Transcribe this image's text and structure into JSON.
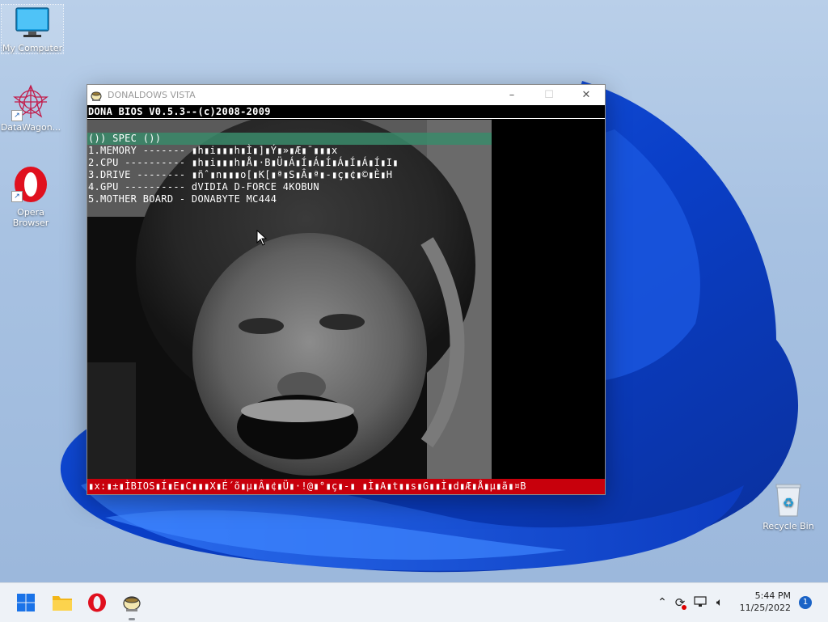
{
  "desktop": {
    "icons": [
      {
        "label": "My Computer"
      },
      {
        "label": "DataWagon..."
      },
      {
        "label": "Opera Browser"
      }
    ],
    "recycle_bin": "Recycle Bin"
  },
  "window": {
    "title": "DONALDOWS VISTA",
    "minimize_icon": "–",
    "maximize_icon": "☐",
    "close_icon": "✕",
    "bios_header": "DONA BIOS V0.5.3--(c)2008-2009",
    "spec_title": "()) SPEC ())",
    "lines": [
      "1.MEMORY ------- ▮h▮i▮▮▮h▮Ì▮]▮Ý▮»▮Æ▮¯▮▮▮x",
      "2.CPU ---------- ▮h▮i▮▮▮h▮Å▮·B▮Ü▮Á▮Í▮Á▮Í▮Á▮Í▮Á▮Í▮I▮",
      "3.DRIVE -------- ▮ñˆ▮n▮▮▮o[▮K[▮ª▮S▮Â▮ª▮-▮ç▮¢▮©▮È▮H",
      "4.GPU ---------- dVIDIA D-FORCE 4KOBUN",
      "5.MOTHER BOARD - DONABYTE MC444"
    ],
    "status_line": "▮x:▮±▮ÌBIOS▮Í▮E▮C▮▮▮X▮É´õ▮µ▮Â▮¢▮Ü▮·!@▮°▮ç▮-▮ ▮Ì▮A▮t▮▮s▮G▮▮Ì▮d▮Æ▮Å▮µ▮ã▮¤B"
  },
  "taskbar": {
    "start": "start-icon",
    "pinned": [
      "file-explorer-icon",
      "opera-icon",
      "donaldows-app-icon"
    ],
    "tray_icons": [
      "chevron-up-icon",
      "sync-icon",
      "network-icon",
      "volume-icon"
    ],
    "time": "5:44 PM",
    "date": "11/25/2022",
    "notification_count": "1"
  }
}
